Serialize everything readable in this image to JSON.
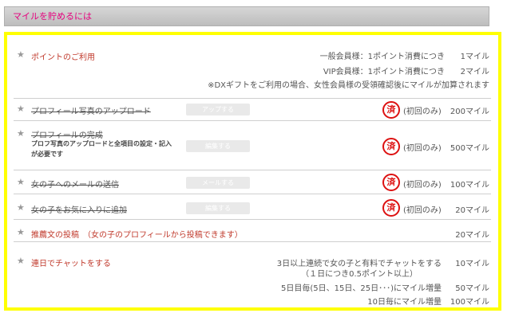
{
  "header": {
    "title": "マイルを貯めるには"
  },
  "rows": {
    "point_use": {
      "label": "ポイントのご利用",
      "lines": [
        {
          "text": "一般会員様：1ポイント消費につき",
          "miles": "1マイル"
        },
        {
          "text": "VIP会員様：1ポイント消費につき",
          "miles": "2マイル"
        }
      ],
      "note": "※DXギフトをご利用の場合、女性会員様の受領確認後にマイルが加算されます"
    },
    "photo_upload": {
      "label": "プロフィール写真のアップロード",
      "button": "アップする",
      "stamp": "済",
      "first_only": "(初回のみ)",
      "miles": "200マイル"
    },
    "profile_complete": {
      "label": "プロフィールの完成",
      "sub1": "プロフ写真のアップロードと全項目の設定・記入",
      "sub2": "が必要です",
      "button": "編集する",
      "stamp": "済",
      "first_only": "(初回のみ)",
      "miles": "500マイル"
    },
    "send_mail": {
      "label": "女の子へのメールの送信",
      "button": "メールする",
      "stamp": "済",
      "first_only": "(初回のみ)",
      "miles": "100マイル"
    },
    "add_favorite": {
      "label": "女の子をお気に入りに追加",
      "button": "編集する",
      "stamp": "済",
      "first_only": "(初回のみ)",
      "miles": "20マイル"
    },
    "recommendation": {
      "label": "推薦文の投稿　（女の子のプロフィールから投稿できます）",
      "miles": "20マイル"
    },
    "chat_daily": {
      "label": "連日でチャットをする",
      "lines": [
        {
          "text": "3日以上連続で女の子と有料でチャットをする",
          "miles": "10マイル"
        },
        {
          "text": "（１日につき0.5ポイント以上）",
          "miles": ""
        },
        {
          "text": "5日目毎(5日、15日、25日･･･)にマイル増量",
          "miles": "50マイル"
        },
        {
          "text": "10日毎にマイル増量",
          "miles": "100マイル"
        }
      ]
    }
  }
}
